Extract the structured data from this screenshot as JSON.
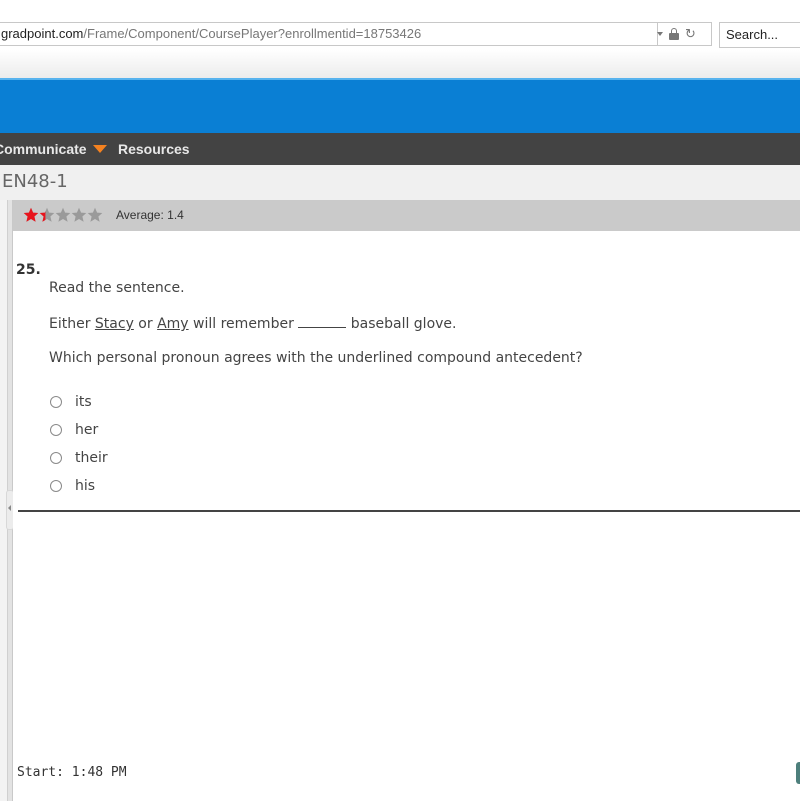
{
  "browser": {
    "url_host": "gradpoint.com",
    "url_path": "/Frame/Component/CoursePlayer?enrollmentid=18753426",
    "search_placeholder": "Search..."
  },
  "nav": {
    "items": [
      {
        "label": "Communicate",
        "has_dropdown": true
      },
      {
        "label": "Resources",
        "has_dropdown": false
      }
    ],
    "accent_color": "#f58220",
    "banner_color": "#0a7fd4"
  },
  "course": {
    "title": "EN48-1"
  },
  "rating": {
    "average_label": "Average: 1.4",
    "average_value": 1.4,
    "max_stars": 5
  },
  "question": {
    "number": "25.",
    "prompt_intro": "Read the sentence.",
    "sentence": {
      "part1": "Either ",
      "antecedent1": "Stacy",
      "part2": " or ",
      "antecedent2": "Amy",
      "part3": " will remember ",
      "part4": " baseball glove."
    },
    "prompt": "Which personal pronoun agrees with the underlined compound antecedent?",
    "choices": [
      {
        "label": "its",
        "selected": false
      },
      {
        "label": "her",
        "selected": false
      },
      {
        "label": "their",
        "selected": false
      },
      {
        "label": "his",
        "selected": false
      }
    ]
  },
  "footer": {
    "start_time": "Start: 1:48 PM"
  }
}
